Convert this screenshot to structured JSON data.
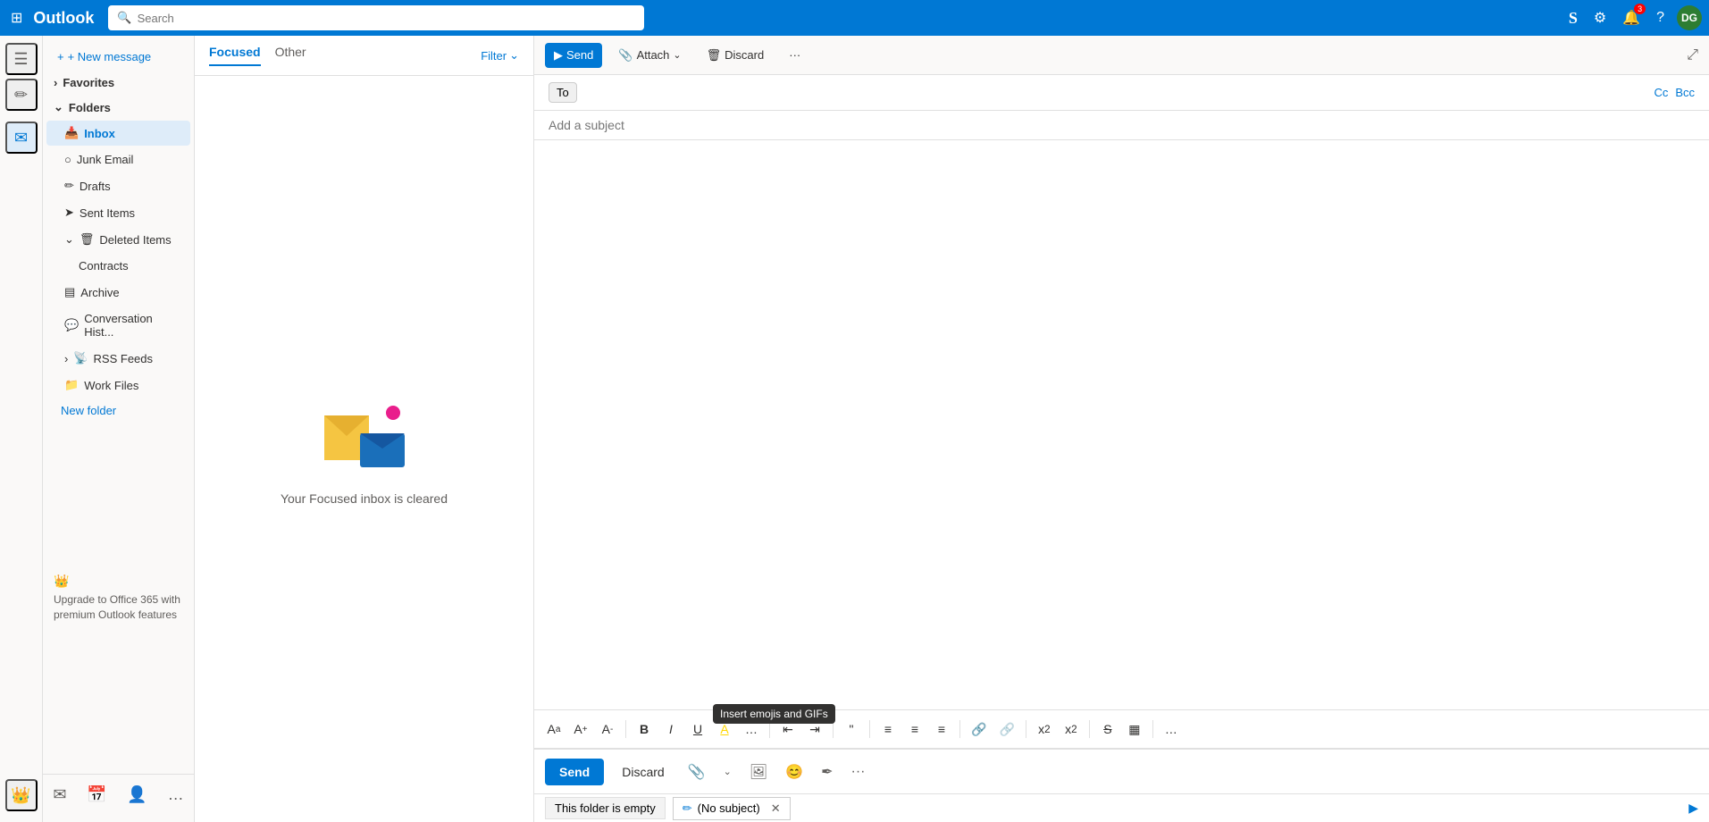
{
  "app": {
    "name": "Outlook",
    "logo": "Outlook"
  },
  "topbar": {
    "search_placeholder": "Search",
    "skype_icon": "S",
    "settings_icon": "⚙",
    "bell_icon": "🔔",
    "bell_badge": "3",
    "help_icon": "?",
    "avatar_initials": "DG",
    "avatar_bg": "#2d7d32"
  },
  "sidebar": {
    "hamburger_label": "☰",
    "new_message_label": "+ New message",
    "favorites": {
      "label": "Favorites",
      "expanded": true
    },
    "folders": {
      "label": "Folders",
      "expanded": true
    },
    "items": [
      {
        "id": "inbox",
        "label": "Inbox",
        "icon": "📥",
        "active": true
      },
      {
        "id": "junk",
        "label": "Junk Email",
        "icon": "🚫"
      },
      {
        "id": "drafts",
        "label": "Drafts",
        "icon": "✏️"
      },
      {
        "id": "sent",
        "label": "Sent Items",
        "icon": "➤"
      },
      {
        "id": "deleted",
        "label": "Deleted Items",
        "icon": "🗑",
        "expanded": true
      },
      {
        "id": "contracts",
        "label": "Contracts",
        "icon": "",
        "sub": true
      },
      {
        "id": "archive",
        "label": "Archive",
        "icon": "📦"
      },
      {
        "id": "conversation",
        "label": "Conversation Hist...",
        "icon": "💬"
      },
      {
        "id": "rss",
        "label": "RSS Feeds",
        "icon": "📡",
        "expandable": true
      },
      {
        "id": "workfiles",
        "label": "Work Files",
        "icon": "📁"
      }
    ],
    "new_folder_label": "New folder",
    "upgrade_text": "Upgrade to Office 365 with premium Outlook features"
  },
  "message_list": {
    "tabs": [
      {
        "id": "focused",
        "label": "Focused",
        "active": true
      },
      {
        "id": "other",
        "label": "Other",
        "active": false
      }
    ],
    "filter_label": "Filter",
    "empty_text": "Your Focused inbox is cleared"
  },
  "compose": {
    "toolbar": {
      "send_label": "Send",
      "attach_label": "Attach",
      "attach_icon": "📎",
      "discard_label": "Discard",
      "discard_icon": "🗑",
      "more_icon": "...",
      "expand_icon": "⤢"
    },
    "to_label": "To",
    "cc_label": "Cc",
    "bcc_label": "Bcc",
    "subject_placeholder": "Add a subject",
    "format_toolbar": {
      "style_icon": "A",
      "font_size_up": "A↑",
      "font_size_down": "A↓",
      "bold": "B",
      "italic": "I",
      "underline": "U",
      "highlight": "ab",
      "more_text": "…",
      "decrease_indent": "⇤",
      "increase_indent": "⇥",
      "quote": "❝",
      "align_left": "≡",
      "align_center": "≡",
      "align_right": "≡",
      "link": "🔗",
      "unlink": "🔗",
      "superscript": "x²",
      "subscript": "x₂",
      "strikethrough": "S̶",
      "insert_inline": "▦",
      "more": "…"
    },
    "send_btn_label": "Send",
    "discard_btn_label": "Discard",
    "emoji_tooltip": "Insert emojis and GIFs"
  },
  "status_bar": {
    "folder_empty_label": "This folder is empty",
    "draft_label": "(No subject)",
    "draft_icon": "✏️",
    "send_icon": "▶"
  },
  "bottom_nav": {
    "mail_icon": "✉",
    "calendar_icon": "📅",
    "people_icon": "👤",
    "more_icon": "…"
  }
}
